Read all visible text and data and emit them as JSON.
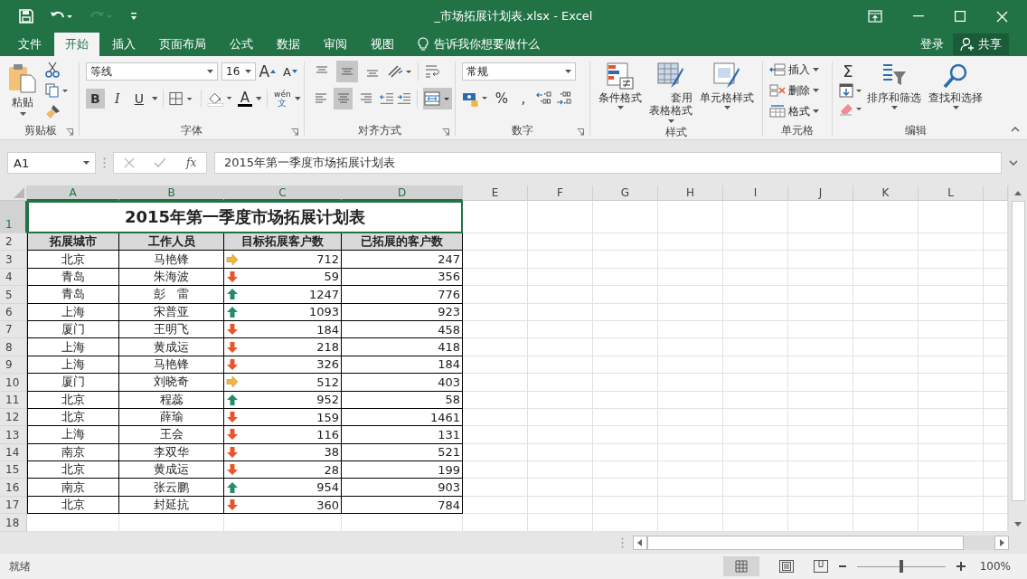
{
  "window": {
    "title": "_市场拓展计划表.xlsx - Excel"
  },
  "menu_tabs": [
    {
      "label": "文件",
      "selected": false
    },
    {
      "label": "开始",
      "selected": true
    },
    {
      "label": "插入",
      "selected": false
    },
    {
      "label": "页面布局",
      "selected": false
    },
    {
      "label": "公式",
      "selected": false
    },
    {
      "label": "数据",
      "selected": false
    },
    {
      "label": "审阅",
      "selected": false
    },
    {
      "label": "视图",
      "selected": false
    }
  ],
  "tell_me": "告诉我你想要做什么",
  "account": {
    "sign_in": "登录",
    "share": "共享"
  },
  "ribbon": {
    "clipboard": {
      "label": "剪贴板",
      "paste": "粘贴"
    },
    "font": {
      "label": "字体",
      "font_name": "等线",
      "font_size": "16",
      "grow": "A",
      "shrink": "A",
      "bold": {
        "label": "B",
        "selected": true
      },
      "italic": {
        "label": "I",
        "selected": false
      },
      "underline": {
        "label": "U",
        "selected": false
      },
      "font_color": "A",
      "phonetic_top": "wén",
      "phonetic_bottom": "文"
    },
    "alignment": {
      "label": "对齐方式",
      "top": false,
      "middle": true,
      "bottom": false,
      "left": false,
      "center": true,
      "right": false,
      "merge": true
    },
    "number": {
      "label": "数字",
      "format": "常规",
      "percent": "%",
      "comma": ","
    },
    "styles": {
      "label": "样式",
      "buttons": [
        "条件格式",
        "套用表格格式",
        "单元格样式"
      ]
    },
    "cells": {
      "label": "单元格",
      "buttons": [
        "插入",
        "删除",
        "格式"
      ]
    },
    "editing": {
      "label": "编辑",
      "autosum": "Σ",
      "buttons": [
        "排序和筛选",
        "查找和选择"
      ]
    }
  },
  "formula_bar": {
    "name_box": "A1",
    "function_label": "fx",
    "formula": "2015年第一季度市场拓展计划表"
  },
  "sheet": {
    "columns": [
      {
        "label": "A",
        "selected": true
      },
      {
        "label": "B",
        "selected": true
      },
      {
        "label": "C",
        "selected": true
      },
      {
        "label": "D",
        "selected": true
      },
      {
        "label": "E",
        "selected": false
      },
      {
        "label": "F",
        "selected": false
      },
      {
        "label": "G",
        "selected": false
      },
      {
        "label": "H",
        "selected": false
      },
      {
        "label": "I",
        "selected": false
      },
      {
        "label": "J",
        "selected": false
      },
      {
        "label": "K",
        "selected": false
      },
      {
        "label": "L",
        "selected": false
      }
    ],
    "title_row": {
      "row": "1",
      "selected": true,
      "text": "2015年第一季度市场拓展计划表"
    },
    "header_row": {
      "row": "2",
      "cells": [
        "拓展城市",
        "工作人员",
        "目标拓展客户数",
        "已拓展的客户数"
      ]
    },
    "rows": [
      {
        "row": "3",
        "city": "北京",
        "staff": "马艳锋",
        "kind": "flat",
        "target": "712",
        "reached": "247"
      },
      {
        "row": "4",
        "city": "青岛",
        "staff": "朱海波",
        "kind": "down",
        "target": "59",
        "reached": "356"
      },
      {
        "row": "5",
        "city": "青岛",
        "staff": "彭　雷",
        "kind": "up",
        "target": "1247",
        "reached": "776"
      },
      {
        "row": "6",
        "city": "上海",
        "staff": "宋普亚",
        "kind": "up",
        "target": "1093",
        "reached": "923"
      },
      {
        "row": "7",
        "city": "厦门",
        "staff": "王明飞",
        "kind": "down",
        "target": "184",
        "reached": "458"
      },
      {
        "row": "8",
        "city": "上海",
        "staff": "黄成运",
        "kind": "down",
        "target": "218",
        "reached": "418"
      },
      {
        "row": "9",
        "city": "上海",
        "staff": "马艳锋",
        "kind": "down",
        "target": "326",
        "reached": "184"
      },
      {
        "row": "10",
        "city": "厦门",
        "staff": "刘晓奇",
        "kind": "flat",
        "target": "512",
        "reached": "403"
      },
      {
        "row": "11",
        "city": "北京",
        "staff": "程蕊",
        "kind": "up",
        "target": "952",
        "reached": "58"
      },
      {
        "row": "12",
        "city": "北京",
        "staff": "薛瑜",
        "kind": "down",
        "target": "159",
        "reached": "1461"
      },
      {
        "row": "13",
        "city": "上海",
        "staff": "王会",
        "kind": "down",
        "target": "116",
        "reached": "131"
      },
      {
        "row": "14",
        "city": "南京",
        "staff": "李双华",
        "kind": "down",
        "target": "38",
        "reached": "521"
      },
      {
        "row": "15",
        "city": "北京",
        "staff": "黄成运",
        "kind": "down",
        "target": "28",
        "reached": "199"
      },
      {
        "row": "16",
        "city": "南京",
        "staff": "张云鹏",
        "kind": "up",
        "target": "954",
        "reached": "903"
      },
      {
        "row": "17",
        "city": "北京",
        "staff": "封延抗",
        "kind": "down",
        "target": "360",
        "reached": "784"
      }
    ],
    "empty_rows": [
      "18"
    ]
  },
  "status_bar": {
    "status": "就绪",
    "zoom": {
      "level": 0.5,
      "reading": "100%"
    }
  }
}
